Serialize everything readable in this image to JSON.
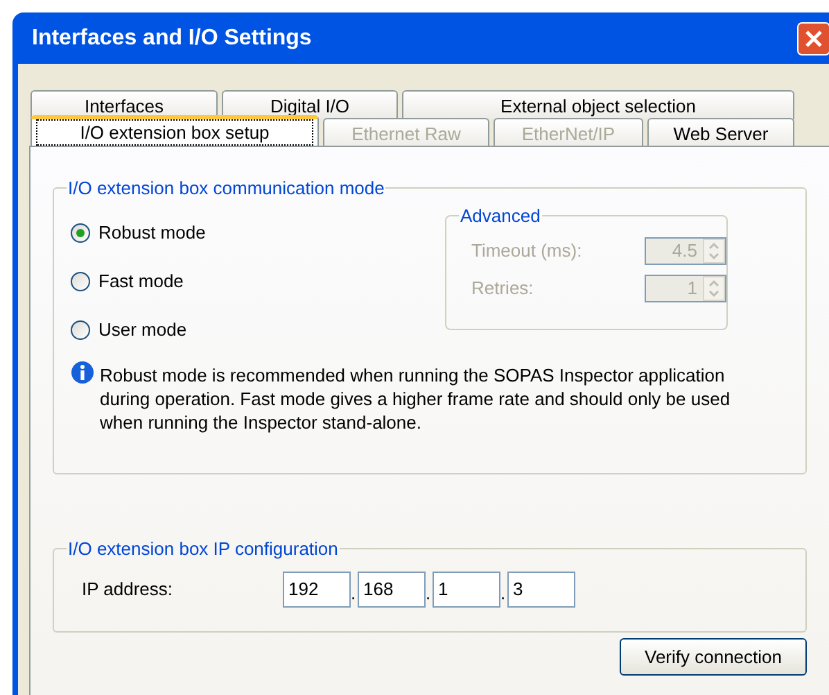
{
  "window": {
    "title": "Interfaces and I/O Settings"
  },
  "tab_rows": [
    [
      {
        "label": "Interfaces",
        "selected": false,
        "disabled": false
      },
      {
        "label": "Digital I/O",
        "selected": false,
        "disabled": false
      },
      {
        "label": "External object selection",
        "selected": false,
        "disabled": false
      }
    ],
    [
      {
        "label": "I/O extension box setup",
        "selected": true,
        "disabled": false
      },
      {
        "label": "Ethernet Raw",
        "selected": false,
        "disabled": true
      },
      {
        "label": "EtherNet/IP",
        "selected": false,
        "disabled": true
      },
      {
        "label": "Web Server",
        "selected": false,
        "disabled": false
      }
    ]
  ],
  "comm_group": {
    "title": "I/O extension box communication mode",
    "modes": [
      {
        "label": "Robust mode",
        "selected": true
      },
      {
        "label": "Fast mode",
        "selected": false
      },
      {
        "label": "User mode",
        "selected": false
      }
    ],
    "advanced": {
      "title": "Advanced",
      "disabled": true,
      "fields": [
        {
          "label": "Timeout (ms):",
          "value": "4.5"
        },
        {
          "label": "Retries:",
          "value": "1"
        }
      ]
    },
    "info": "Robust mode is recommended when running the SOPAS Inspector application during operation. Fast mode gives a higher frame rate and should only be used when running the Inspector stand-alone."
  },
  "ip_group": {
    "title": "I/O extension box IP configuration",
    "label": "IP address:",
    "octets": [
      "192",
      "168",
      "1",
      "3"
    ],
    "separators": [
      ".",
      ".",
      "."
    ]
  },
  "buttons": [
    "Verify connection"
  ]
}
